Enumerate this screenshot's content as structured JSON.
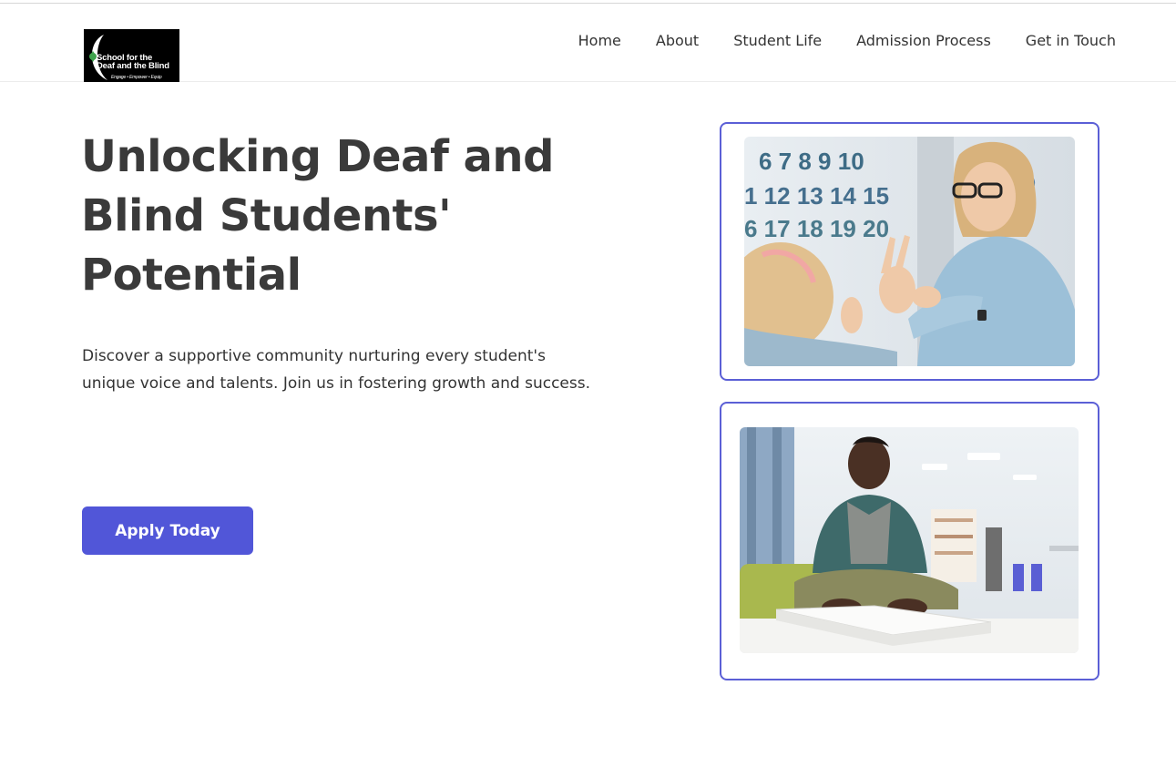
{
  "logo": {
    "line1": "School for the",
    "line2": "Deaf and the Blind",
    "tagline": "Engage • Empower • Equip"
  },
  "nav": {
    "items": [
      {
        "label": "Home"
      },
      {
        "label": "About"
      },
      {
        "label": "Student Life"
      },
      {
        "label": "Admission Process"
      },
      {
        "label": "Get in Touch"
      }
    ]
  },
  "hero": {
    "title": "Unlocking Deaf and Blind Students' Potential",
    "description": "Discover a supportive community nurturing every student's unique voice and talents. Join us in fostering growth and success.",
    "cta_label": "Apply Today"
  },
  "photos": {
    "numbers_row1": "6 7 8 9 10",
    "numbers_row2": "1 12 13 14 15",
    "numbers_row3": "6 17 18 19 20"
  },
  "colors": {
    "accent": "#5156d8",
    "card_border": "#5b5fd6",
    "text": "#3a3a3a"
  }
}
